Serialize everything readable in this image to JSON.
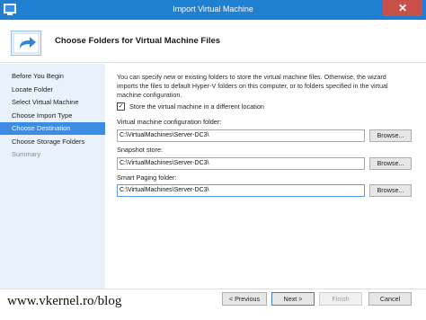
{
  "window": {
    "title": "Import Virtual Machine",
    "close_label": "✕"
  },
  "header": {
    "title": "Choose Folders for Virtual Machine Files"
  },
  "nav": {
    "items": [
      {
        "label": "Before You Begin",
        "state": "normal"
      },
      {
        "label": "Locate Folder",
        "state": "normal"
      },
      {
        "label": "Select Virtual Machine",
        "state": "normal"
      },
      {
        "label": "Choose Import Type",
        "state": "normal"
      },
      {
        "label": "Choose Destination",
        "state": "active"
      },
      {
        "label": "Choose Storage Folders",
        "state": "normal"
      },
      {
        "label": "Summary",
        "state": "disabled"
      }
    ]
  },
  "main": {
    "description_line1": "You can specify new or existing folders to store the virtual machine files. Otherwise, the wizard",
    "description_line2": "imports the files to default Hyper-V folders on this computer, or to folders specified in the virtual",
    "description_line3": "machine configuration.",
    "store_checkbox": {
      "label": "Store the virtual machine in a different location",
      "checked": true,
      "mark": "✓"
    },
    "fields": [
      {
        "label": "Virtual machine configuration folder:",
        "value": "C:\\VirtualMachines\\Server-DC3\\",
        "browse": "Browse..."
      },
      {
        "label": "Snapshot store:",
        "value": "C:\\VirtualMachines\\Server-DC3\\",
        "browse": "Browse..."
      },
      {
        "label": "Smart Paging folder:",
        "value": "C:\\VirtualMachines\\Server-DC3\\",
        "browse": "Browse..."
      }
    ]
  },
  "footer": {
    "watermark": "www.vkernel.ro/blog",
    "previous": "< Previous",
    "next": "Next >",
    "finish": "Finish",
    "cancel": "Cancel"
  },
  "colors": {
    "titlebar": "#1f7fd0",
    "nav_bg": "#e9f1fb",
    "nav_active": "#3d8be3",
    "close": "#c7504b"
  }
}
